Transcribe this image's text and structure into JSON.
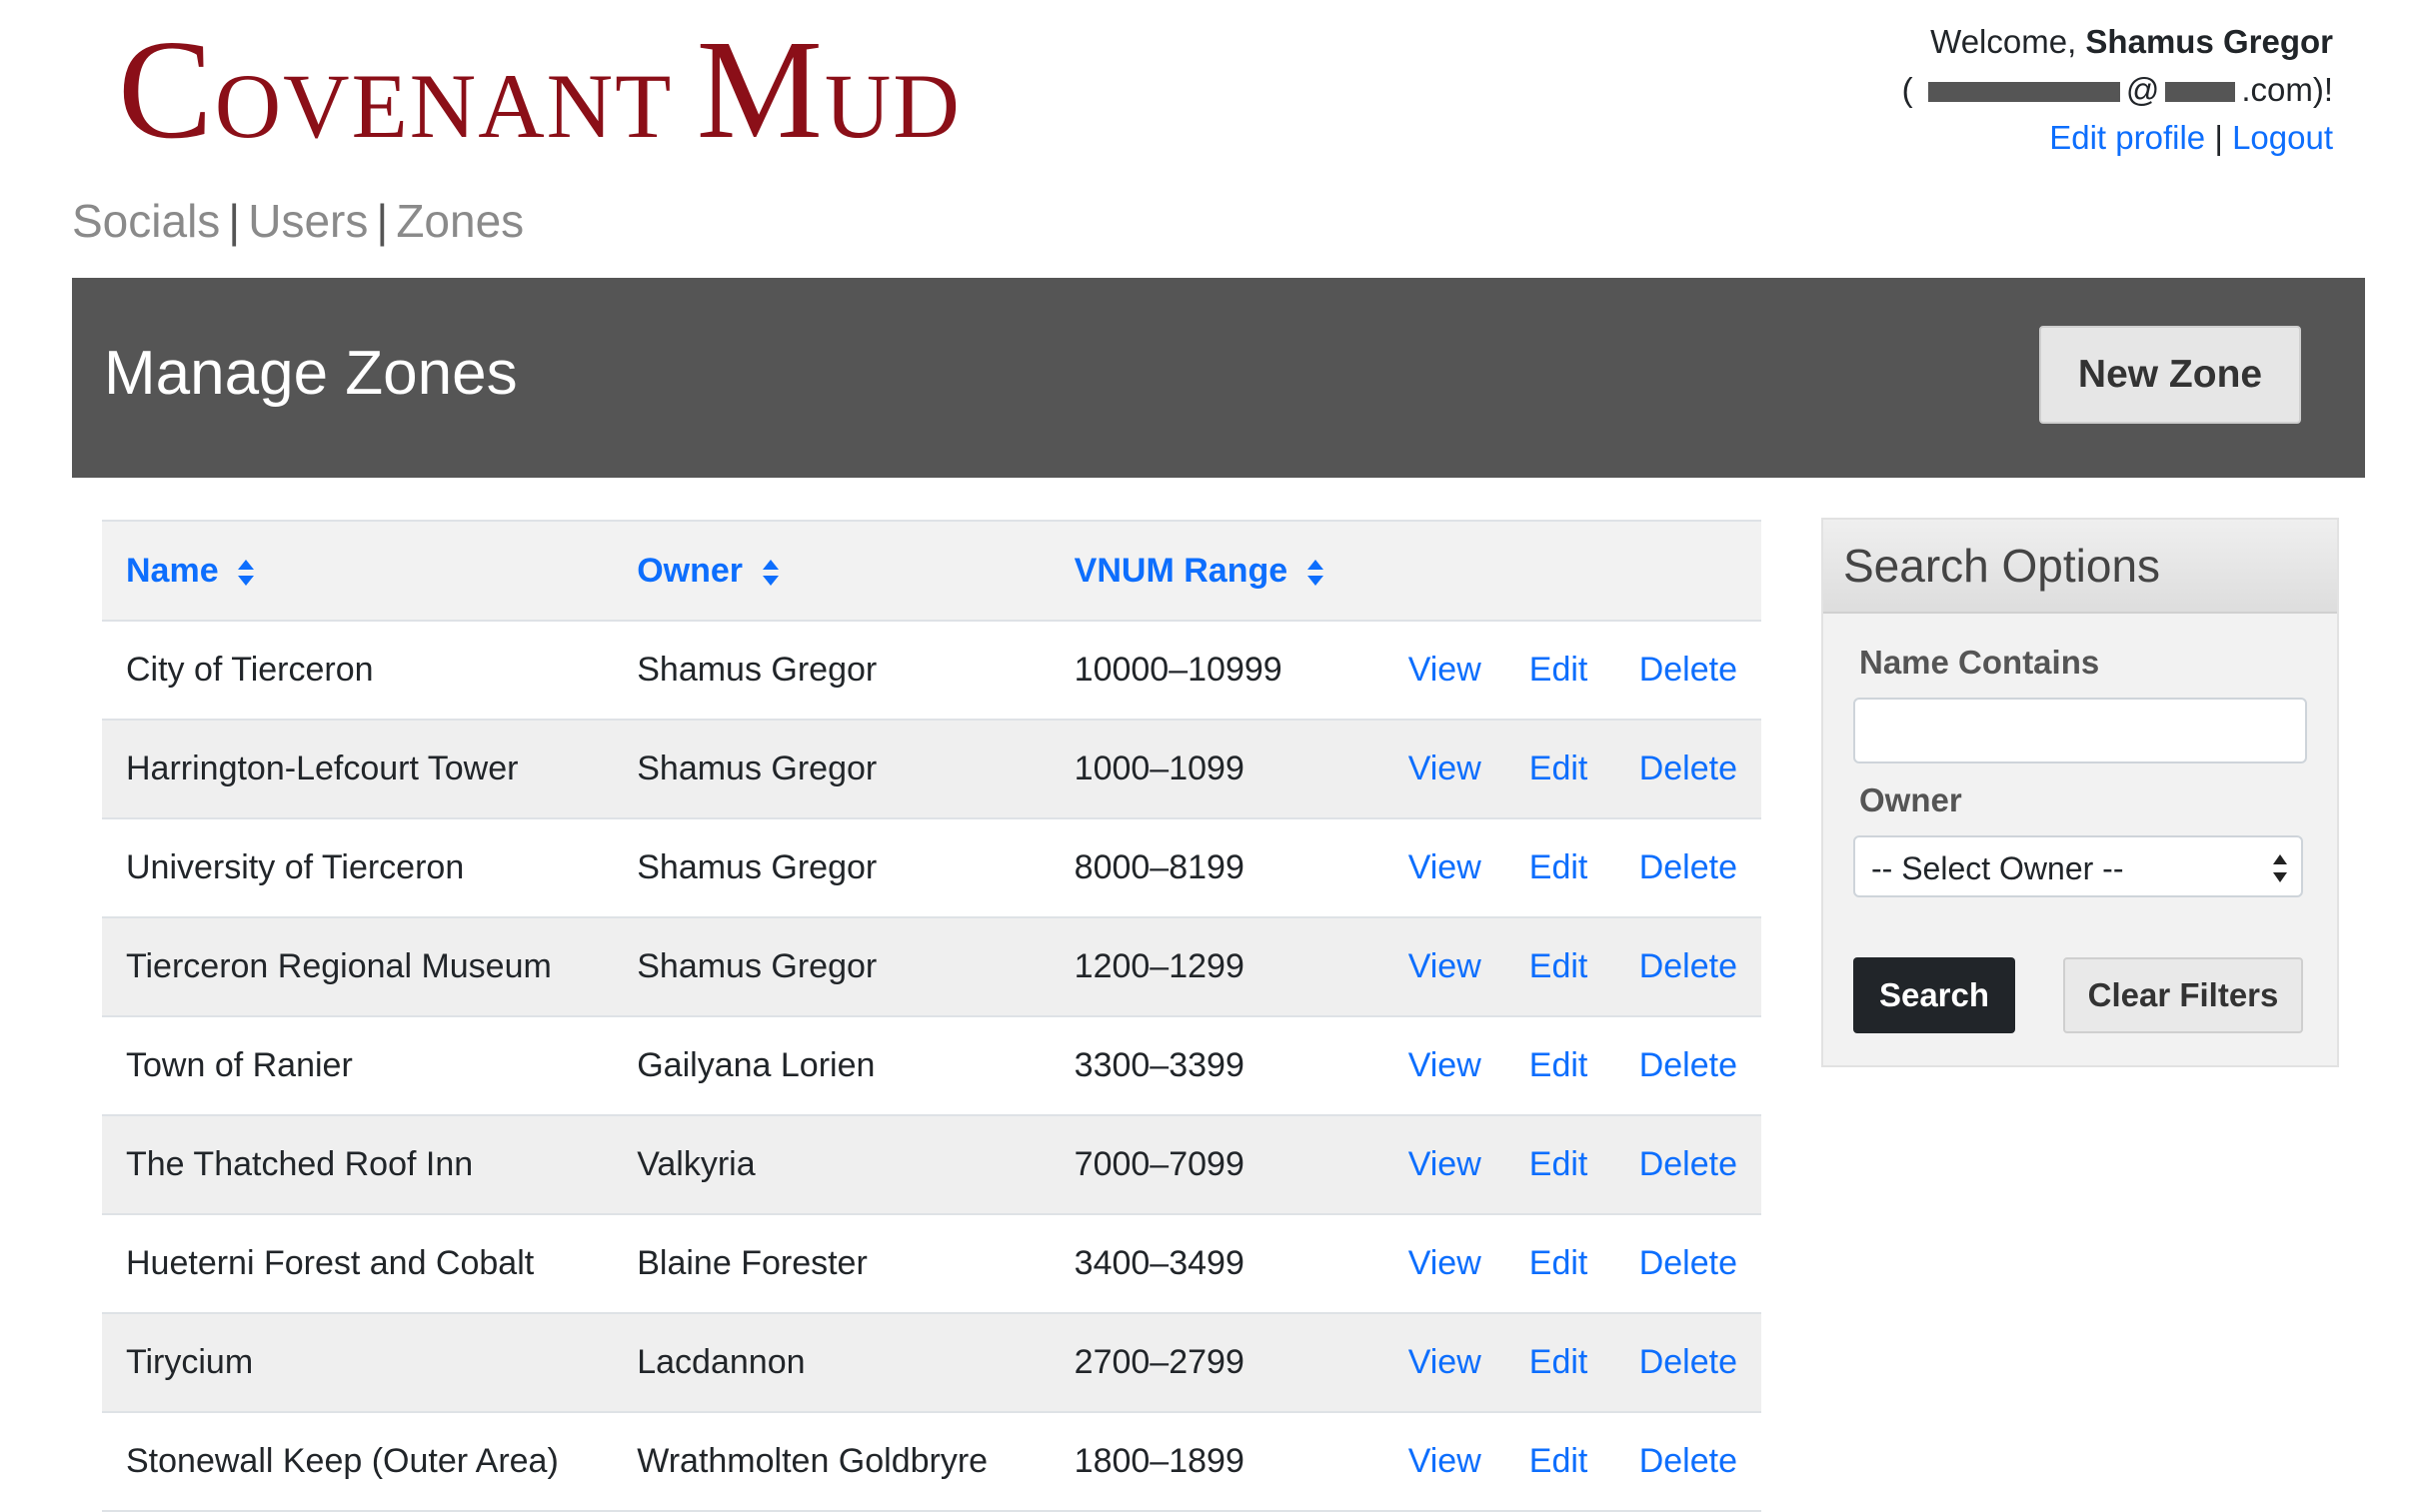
{
  "site": {
    "logo_first_cap": "C",
    "logo_first_rest": "OVENANT",
    "logo_second_cap": "M",
    "logo_second_rest": "UD"
  },
  "user": {
    "welcome_prefix": "Welcome,",
    "name": "Shamus Gregor",
    "email_open": "(",
    "email_at": "@",
    "email_close": ".com)!",
    "edit_profile": "Edit profile",
    "separator": "|",
    "logout": "Logout"
  },
  "nav": {
    "items": [
      "Socials",
      "Users",
      "Zones"
    ],
    "separator": "|"
  },
  "page": {
    "title": "Manage Zones",
    "new_button": "New Zone"
  },
  "table": {
    "columns": [
      "Name",
      "Owner",
      "VNUM Range"
    ],
    "action_labels": {
      "view": "View",
      "edit": "Edit",
      "delete": "Delete"
    },
    "rows": [
      {
        "name": "City of Tierceron",
        "owner": "Shamus Gregor",
        "vnum": "10000–10999"
      },
      {
        "name": "Harrington-Lefcourt Tower",
        "owner": "Shamus Gregor",
        "vnum": "1000–1099"
      },
      {
        "name": "University of Tierceron",
        "owner": "Shamus Gregor",
        "vnum": "8000–8199"
      },
      {
        "name": "Tierceron Regional Museum",
        "owner": "Shamus Gregor",
        "vnum": "1200–1299"
      },
      {
        "name": "Town of Ranier",
        "owner": "Gailyana Lorien",
        "vnum": "3300–3399"
      },
      {
        "name": "The Thatched Roof Inn",
        "owner": "Valkyria",
        "vnum": "7000–7099"
      },
      {
        "name": "Hueterni Forest and Cobalt",
        "owner": "Blaine Forester",
        "vnum": "3400–3499"
      },
      {
        "name": "Tirycium",
        "owner": "Lacdannon",
        "vnum": "2700–2799"
      },
      {
        "name": "Stonewall Keep (Outer Area)",
        "owner": "Wrathmolten Goldbryre",
        "vnum": "1800–1899"
      }
    ]
  },
  "search": {
    "title": "Search Options",
    "name_label": "Name Contains",
    "name_value": "",
    "owner_label": "Owner",
    "owner_selected": "-- Select Owner --",
    "search_button": "Search",
    "clear_button": "Clear Filters"
  },
  "colors": {
    "brand": "#8b0f18",
    "link": "#0d6efd",
    "banner": "#555555"
  }
}
